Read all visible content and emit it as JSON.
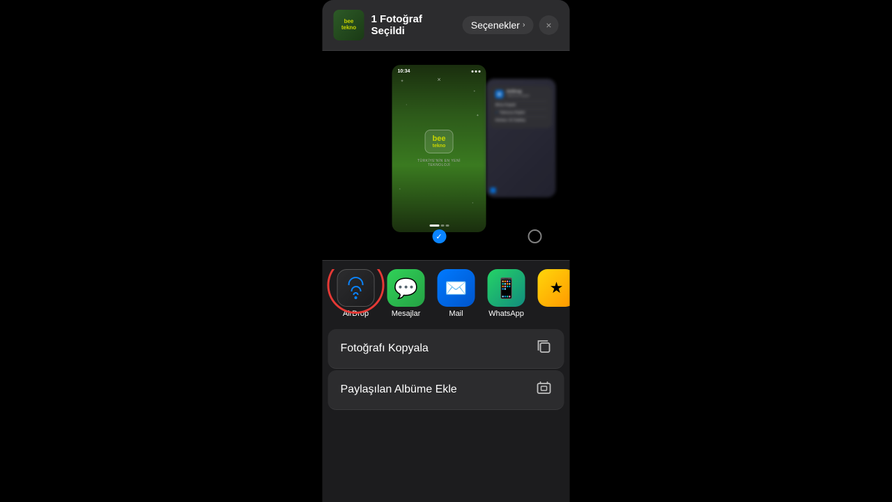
{
  "background": "#000000",
  "shareSheet": {
    "title": "1 Fotoğraf Seçildi",
    "optionsButton": "Seçenekler",
    "closeButton": "×"
  },
  "photoPreview": {
    "beeLogo": {
      "line1": "bee",
      "line2": "tekno",
      "slogan": "TÜRKİYE'NİN EN YENİ\nTEKNOLOJİ"
    },
    "statusTime": "10:34",
    "airdropOverlay": {
      "title": "AirDrop",
      "subtitle": "Yalnızca Kişiler",
      "options": [
        "Alma Kapalı",
        "Yalnızca Kişiler",
        "Herkes 10 Dakika"
      ]
    }
  },
  "apps": [
    {
      "id": "airdrop",
      "label": "AirDrop",
      "type": "airdrop"
    },
    {
      "id": "messages",
      "label": "Mesajlar",
      "type": "messages"
    },
    {
      "id": "mail",
      "label": "Mail",
      "type": "mail"
    },
    {
      "id": "whatsapp",
      "label": "WhatsApp",
      "type": "whatsapp"
    },
    {
      "id": "more",
      "label": "",
      "type": "partial"
    }
  ],
  "actions": [
    {
      "id": "copy-photo",
      "label": "Fotoğrafı Kopyala",
      "icon": "copy"
    },
    {
      "id": "add-album",
      "label": "Paylaşılan Albüme Ekle",
      "icon": "album"
    }
  ]
}
